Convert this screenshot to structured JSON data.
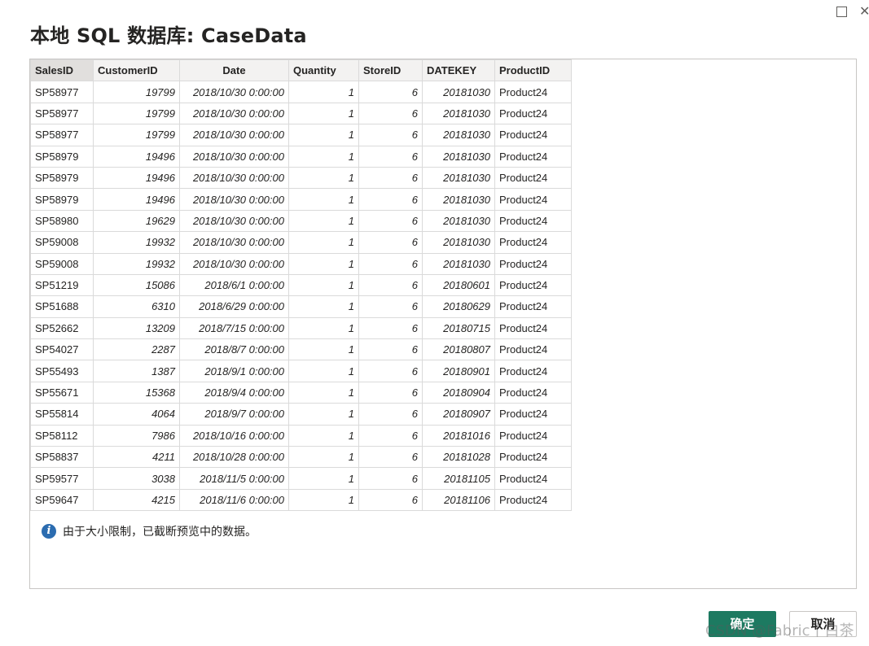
{
  "window": {
    "maximize_glyph": "",
    "close_glyph": "✕"
  },
  "dialog": {
    "title": "本地 SQL 数据库: CaseData"
  },
  "table": {
    "columns": [
      "SalesID",
      "CustomerID",
      "Date",
      "Quantity",
      "StoreID",
      "DATEKEY",
      "ProductID"
    ],
    "rows": [
      [
        "SP58977",
        "19799",
        "2018/10/30 0:00:00",
        "1",
        "6",
        "20181030",
        "Product24"
      ],
      [
        "SP58977",
        "19799",
        "2018/10/30 0:00:00",
        "1",
        "6",
        "20181030",
        "Product24"
      ],
      [
        "SP58977",
        "19799",
        "2018/10/30 0:00:00",
        "1",
        "6",
        "20181030",
        "Product24"
      ],
      [
        "SP58979",
        "19496",
        "2018/10/30 0:00:00",
        "1",
        "6",
        "20181030",
        "Product24"
      ],
      [
        "SP58979",
        "19496",
        "2018/10/30 0:00:00",
        "1",
        "6",
        "20181030",
        "Product24"
      ],
      [
        "SP58979",
        "19496",
        "2018/10/30 0:00:00",
        "1",
        "6",
        "20181030",
        "Product24"
      ],
      [
        "SP58980",
        "19629",
        "2018/10/30 0:00:00",
        "1",
        "6",
        "20181030",
        "Product24"
      ],
      [
        "SP59008",
        "19932",
        "2018/10/30 0:00:00",
        "1",
        "6",
        "20181030",
        "Product24"
      ],
      [
        "SP59008",
        "19932",
        "2018/10/30 0:00:00",
        "1",
        "6",
        "20181030",
        "Product24"
      ],
      [
        "SP51219",
        "15086",
        "2018/6/1 0:00:00",
        "1",
        "6",
        "20180601",
        "Product24"
      ],
      [
        "SP51688",
        "6310",
        "2018/6/29 0:00:00",
        "1",
        "6",
        "20180629",
        "Product24"
      ],
      [
        "SP52662",
        "13209",
        "2018/7/15 0:00:00",
        "1",
        "6",
        "20180715",
        "Product24"
      ],
      [
        "SP54027",
        "2287",
        "2018/8/7 0:00:00",
        "1",
        "6",
        "20180807",
        "Product24"
      ],
      [
        "SP55493",
        "1387",
        "2018/9/1 0:00:00",
        "1",
        "6",
        "20180901",
        "Product24"
      ],
      [
        "SP55671",
        "15368",
        "2018/9/4 0:00:00",
        "1",
        "6",
        "20180904",
        "Product24"
      ],
      [
        "SP55814",
        "4064",
        "2018/9/7 0:00:00",
        "1",
        "6",
        "20180907",
        "Product24"
      ],
      [
        "SP58112",
        "7986",
        "2018/10/16 0:00:00",
        "1",
        "6",
        "20181016",
        "Product24"
      ],
      [
        "SP58837",
        "4211",
        "2018/10/28 0:00:00",
        "1",
        "6",
        "20181028",
        "Product24"
      ],
      [
        "SP59577",
        "3038",
        "2018/11/5 0:00:00",
        "1",
        "6",
        "20181105",
        "Product24"
      ],
      [
        "SP59647",
        "4215",
        "2018/11/6 0:00:00",
        "1",
        "6",
        "20181106",
        "Product24"
      ]
    ]
  },
  "notice": {
    "icon": "info-icon",
    "text": "由于大小限制，已截断预览中的数据。"
  },
  "buttons": {
    "ok_label": "确定",
    "cancel_label": "取消"
  },
  "watermark": "CSDN @Fabric丨白茶",
  "colors": {
    "primary_button": "#1d7a61",
    "info_icon": "#2b6cb0"
  }
}
